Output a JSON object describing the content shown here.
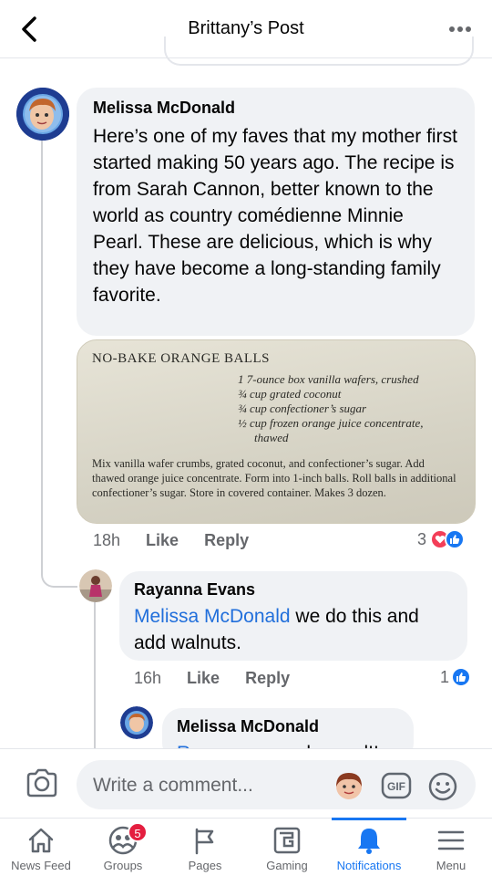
{
  "header": {
    "title": "Brittany’s Post",
    "back_icon": "back-chevron-icon",
    "more_icon": "more-dots-icon"
  },
  "comments": [
    {
      "author": "Melissa McDonald",
      "text": "Here’s one of my faves that my mother first started making 50 years ago. The recipe is from Sarah Cannon, better known to the world as country comédienne Minnie Pearl. These are delicious, which is why they have become a long-standing family favorite.",
      "time": "18h",
      "like_label": "Like",
      "reply_label": "Reply",
      "reaction_count": "3",
      "reactions": [
        "love",
        "like"
      ],
      "photo": {
        "title": "NO-BAKE ORANGE BALLS",
        "ingredients": [
          "1 7-ounce box vanilla wafers, crushed",
          "¾ cup grated coconut",
          "¾ cup confectioner’s sugar",
          "½ cup frozen orange juice concentrate,",
          "thawed"
        ],
        "directions": "Mix vanilla wafer crumbs, grated coconut, and confectioner’s sugar. Add thawed orange juice concentrate. Form into 1-inch balls. Roll balls in additional confectioner’s sugar. Store in covered container. Makes 3 dozen."
      }
    },
    {
      "author": "Rayanna Evans",
      "mention": "Melissa McDonald",
      "text": " we do this and add walnuts.",
      "time": "16h",
      "like_label": "Like",
      "reply_label": "Reply",
      "reaction_count": "1",
      "reactions": [
        "like"
      ]
    },
    {
      "author": "Melissa McDonald",
      "mention": "Rayanna",
      "text": " sounds good!!"
    }
  ],
  "composer": {
    "placeholder": "Write a comment...",
    "camera_icon": "camera-icon",
    "gif_label": "GIF",
    "emoji_icon": "smiley-icon"
  },
  "nav": {
    "items": [
      {
        "label": "News Feed",
        "icon": "home-icon"
      },
      {
        "label": "Groups",
        "icon": "groups-icon",
        "badge": "5"
      },
      {
        "label": "Pages",
        "icon": "flag-icon"
      },
      {
        "label": "Gaming",
        "icon": "gaming-icon"
      },
      {
        "label": "Notifications",
        "icon": "bell-icon",
        "active": true
      },
      {
        "label": "Menu",
        "icon": "hamburger-icon"
      }
    ]
  },
  "colors": {
    "accent": "#1877f2",
    "mention": "#216fdb",
    "bubble": "#f0f2f5",
    "badge": "#e41e3f",
    "love": "#f33e58"
  }
}
